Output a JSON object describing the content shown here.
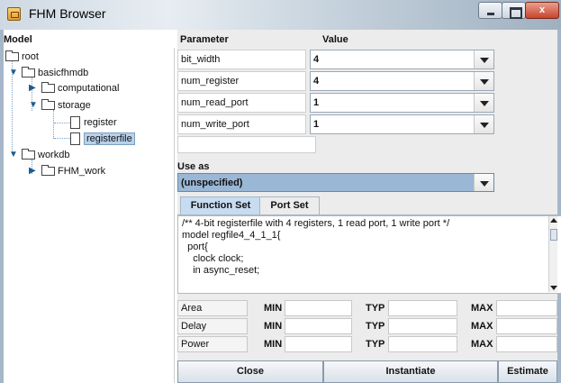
{
  "window": {
    "title": "FHM Browser",
    "minimize_label": "",
    "maximize_label": "",
    "close_label": "x"
  },
  "tree": {
    "header": "Model",
    "nodes": {
      "root": "root",
      "basicfhmdb": "basicfhmdb",
      "computational": "computational",
      "storage": "storage",
      "register": "register",
      "registerfile": "registerfile",
      "workdb": "workdb",
      "fhm_work": "FHM_work"
    },
    "selected": "registerfile"
  },
  "params": {
    "header_param": "Parameter",
    "header_value": "Value",
    "rows": [
      {
        "name": "bit_width",
        "value": "4"
      },
      {
        "name": "num_register",
        "value": "4"
      },
      {
        "name": "num_read_port",
        "value": "1"
      },
      {
        "name": "num_write_port",
        "value": "1"
      }
    ]
  },
  "use_as": {
    "label": "Use as",
    "value": "(unspecified)"
  },
  "tabs": {
    "function_set": "Function Set",
    "port_set": "Port Set",
    "active": "Function Set"
  },
  "code": {
    "lines": [
      "/** 4-bit registerfile with 4 registers, 1 read port, 1 write port */",
      "model regfile4_4_1_1{",
      "  port{",
      "    clock clock;",
      "    in async_reset;"
    ]
  },
  "metrics": {
    "min_label": "MIN",
    "typ_label": "TYP",
    "max_label": "MAX",
    "rows": [
      {
        "name": "Area"
      },
      {
        "name": "Delay"
      },
      {
        "name": "Power"
      }
    ]
  },
  "buttons": {
    "close": "Close",
    "instantiate": "Instantiate",
    "estimate": "Estimate"
  },
  "colors": {
    "titlebar": "#cfd9e3",
    "selection": "#b9d1ea",
    "use_as_bg": "#9ab8d6",
    "active_tab": "#c7dcf0",
    "close_button": "#c7442e"
  }
}
